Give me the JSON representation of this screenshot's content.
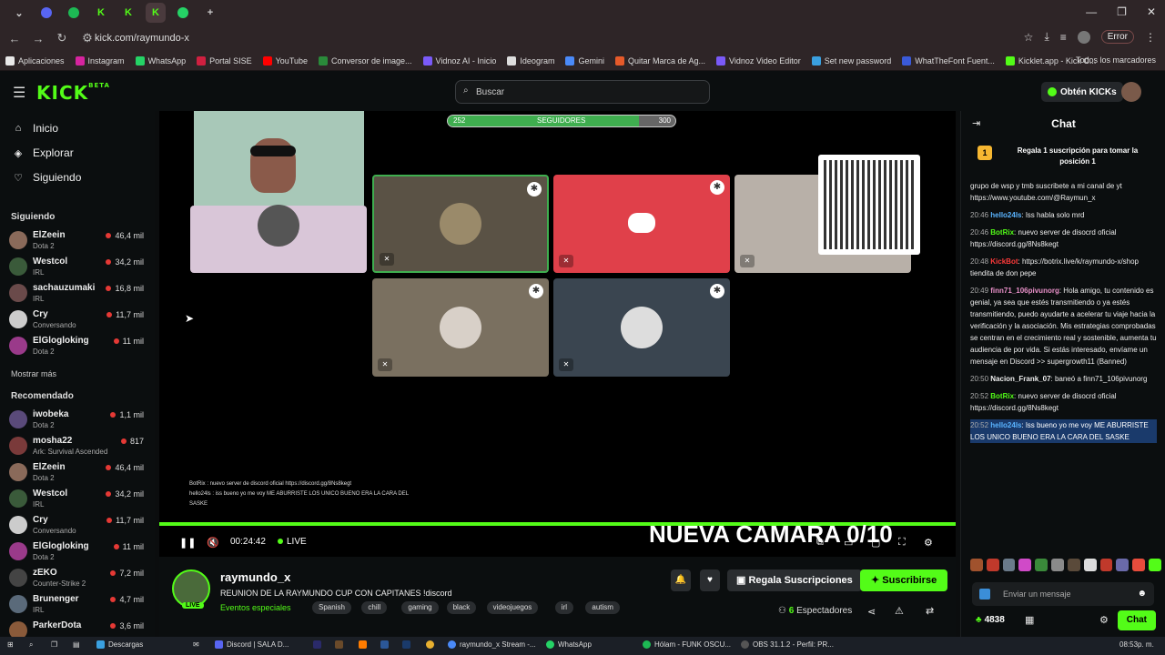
{
  "browser": {
    "url": "kick.com/raymundo-x",
    "error_label": "Error",
    "bookmarks": [
      {
        "label": "Aplicaciones",
        "color": "#e8e8e8"
      },
      {
        "label": "Instagram",
        "color": "#d6249f"
      },
      {
        "label": "WhatsApp",
        "color": "#25d366"
      },
      {
        "label": "Portal SISE",
        "color": "#d02040"
      },
      {
        "label": "YouTube",
        "color": "#ff0000"
      },
      {
        "label": "Conversor de image...",
        "color": "#2a8a3a"
      },
      {
        "label": "Vidnoz AI - Inicio",
        "color": "#7a5af8"
      },
      {
        "label": "Ideogram",
        "color": "#dddddd"
      },
      {
        "label": "Gemini",
        "color": "#4a8af8"
      },
      {
        "label": "Quitar Marca de Ag...",
        "color": "#e65a2a"
      },
      {
        "label": "Vidnoz Video Editor",
        "color": "#7a5af8"
      },
      {
        "label": "Set new password",
        "color": "#3aa0e0"
      },
      {
        "label": "WhatTheFont Fuent...",
        "color": "#3a5ad8"
      },
      {
        "label": "Kicklet.app - Kick C...",
        "color": "#53fc18"
      }
    ],
    "all_bookmarks": "Todos los marcadores"
  },
  "header": {
    "logo": "KICK",
    "beta": "BETA",
    "search_placeholder": "Buscar",
    "kicks_button": "Obtén KICKs"
  },
  "sidebar": {
    "nav": [
      "Inicio",
      "Explorar",
      "Siguiendo"
    ],
    "following_title": "Siguiendo",
    "following": [
      {
        "name": "ElZeein",
        "sub": "Dota 2",
        "viewers": "46,4 mil",
        "color": "#8a6a5a"
      },
      {
        "name": "Westcol",
        "sub": "IRL",
        "viewers": "34,2 mil",
        "color": "#3a5a3a"
      },
      {
        "name": "sachauzumaki",
        "sub": "IRL",
        "viewers": "16,8 mil",
        "color": "#6a4a4a"
      },
      {
        "name": "Cry",
        "sub": "Conversando",
        "viewers": "11,7 mil",
        "color": "#cccccc"
      },
      {
        "name": "ElGlogloking",
        "sub": "Dota 2",
        "viewers": "11 mil",
        "color": "#9a3a8a"
      }
    ],
    "more": "Mostrar más",
    "recommended_title": "Recomendado",
    "recommended": [
      {
        "name": "iwobeka",
        "sub": "Dota 2",
        "viewers": "1,1 mil",
        "color": "#5a4a7a"
      },
      {
        "name": "mosha22",
        "sub": "Ark: Survival Ascended",
        "viewers": "817",
        "color": "#7a3a3a"
      },
      {
        "name": "ElZeein",
        "sub": "Dota 2",
        "viewers": "46,4 mil",
        "color": "#8a6a5a"
      },
      {
        "name": "Westcol",
        "sub": "IRL",
        "viewers": "34,2 mil",
        "color": "#3a5a3a"
      },
      {
        "name": "Cry",
        "sub": "Conversando",
        "viewers": "11,7 mil",
        "color": "#cccccc"
      },
      {
        "name": "ElGlogloking",
        "sub": "Dota 2",
        "viewers": "11 mil",
        "color": "#9a3a8a"
      },
      {
        "name": "zEKO",
        "sub": "Counter-Strike 2",
        "viewers": "7,2 mil",
        "color": "#444444"
      },
      {
        "name": "Brunenger",
        "sub": "IRL",
        "viewers": "4,7 mil",
        "color": "#5a6a7a"
      },
      {
        "name": "ParkerDota",
        "sub": "",
        "viewers": "3,6 mil",
        "color": "#8a5a3a"
      }
    ]
  },
  "player": {
    "followers_current": "252",
    "followers_label": "SEGUIDORES",
    "followers_goal": "300",
    "progress_fraction": 0.84,
    "overlay_chat": [
      "BotRix : nuevo server de discord oficial https://discord.gg/8Ns8kegt",
      "hello24ls : iss bueno yo me voy ME ABURRISTE LOS UNICO BUENO ERA LA CARA DEL SASKE"
    ],
    "banner": "NUEVA CAMARA 0/10",
    "time": "00:24:42",
    "live_label": "LIVE"
  },
  "channel": {
    "name": "raymundo_x",
    "live_badge": "LIVE",
    "title": "REUNION DE LA RAYMUNDO CUP CON CAPITANES !discord",
    "category": "Eventos especiales",
    "tags": [
      "Spanish",
      "chill",
      "gaming",
      "black",
      "videojuegos",
      "irl",
      "autism"
    ],
    "gift_button": "Regala Suscripciones",
    "sub_button": "Suscribirse",
    "viewers_count": "6",
    "viewers_label": "Espectadores"
  },
  "chat": {
    "title": "Chat",
    "pinned": "Regala 1 suscripción para tomar la posición 1",
    "messages": [
      {
        "time": "",
        "user": "",
        "color": "#eeeeee",
        "text": "grupo de wsp y tmb suscribete a mi canal de yt https://www.youtube.com/@Raymun_x"
      },
      {
        "time": "20:46",
        "user": "hello24ls",
        "color": "#5ab4ff",
        "text": "lss habla solo mrd"
      },
      {
        "time": "20:46",
        "user": "BotRix",
        "color": "#53fc18",
        "text": "nuevo server de disocrd oficial https://discord.gg/8Ns8kegt"
      },
      {
        "time": "20:48",
        "user": "KickBot",
        "color": "#ff3a3a",
        "text": "https://botrix.live/k/raymundo-x/shop tiendita de don pepe"
      },
      {
        "time": "20:49",
        "user": "finn71_106pivunorg",
        "color": "#e890c8",
        "text": "Hola amigo, tu contenido es genial, ya sea que estés transmitiendo o ya estés transmitiendo, puedo ayudarte a acelerar tu viaje hacia la verificación y la asociación. Mis estrategias comprobadas se centran en el crecimiento real y sostenible, aumenta tu audiencia de por vida. Si estás interesado, envíame un mensaje en Discord >> supergrowth11 (Banned)"
      },
      {
        "time": "20:50",
        "user": "Nacion_Frank_07",
        "color": "#eeeeee",
        "text": "baneó a finn71_106pivunorg"
      },
      {
        "time": "20:52",
        "user": "BotRix",
        "color": "#53fc18",
        "text": "nuevo server de disocrd oficial https://discord.gg/8Ns8kegt"
      },
      {
        "time": "20:52",
        "user": "hello24ls",
        "color": "#5ab4ff",
        "text": "lss bueno yo me voy ME ABURRISTE LOS UNICO BUENO ERA LA CARA DEL SASKE"
      }
    ],
    "input_placeholder": "Enviar un mensaje",
    "points": "4838",
    "chat_button": "Chat"
  },
  "taskbar": {
    "items": [
      "Descargas",
      "Discord | SALA D...",
      "raymundo_x Stream -...",
      "WhatsApp",
      "Hólam - FUNK OSCU...",
      "OBS 31.1.2 - Perfil: PR..."
    ],
    "clock": "08:53p. m."
  }
}
